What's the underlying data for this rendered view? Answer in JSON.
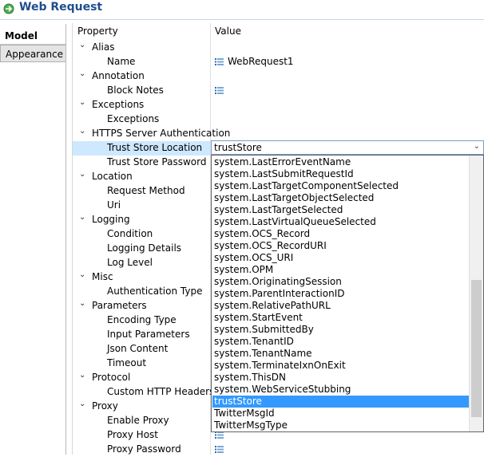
{
  "title": "Web Request",
  "tabs": [
    "Model",
    "Appearance"
  ],
  "headers": {
    "property": "Property",
    "value": "Value"
  },
  "rows": [
    {
      "label": "Alias",
      "level": 0
    },
    {
      "label": "Name",
      "level": 1,
      "value": "WebRequest1",
      "icon": "list-icon"
    },
    {
      "label": "Annotation",
      "level": 0
    },
    {
      "label": "Block Notes",
      "level": 1,
      "value": "",
      "icon": "list-icon"
    },
    {
      "label": "Exceptions",
      "level": 0
    },
    {
      "label": "Exceptions",
      "level": 1
    },
    {
      "label": "HTTPS Server Authentication",
      "level": 0
    },
    {
      "label": "Trust Store Location",
      "level": 1,
      "selected": true
    },
    {
      "label": "Trust Store Password",
      "level": 1
    },
    {
      "label": "Location",
      "level": 0
    },
    {
      "label": "Request Method",
      "level": 1
    },
    {
      "label": "Uri",
      "level": 1
    },
    {
      "label": "Logging",
      "level": 0
    },
    {
      "label": "Condition",
      "level": 1
    },
    {
      "label": "Logging Details",
      "level": 1
    },
    {
      "label": "Log Level",
      "level": 1
    },
    {
      "label": "Misc",
      "level": 0
    },
    {
      "label": "Authentication Type",
      "level": 1
    },
    {
      "label": "Parameters",
      "level": 0
    },
    {
      "label": "Encoding Type",
      "level": 1
    },
    {
      "label": "Input Parameters",
      "level": 1
    },
    {
      "label": "Json Content",
      "level": 1
    },
    {
      "label": "Timeout",
      "level": 1
    },
    {
      "label": "Protocol",
      "level": 0
    },
    {
      "label": "Custom HTTP Headers",
      "level": 1
    },
    {
      "label": "Proxy",
      "level": 0
    },
    {
      "label": "Enable Proxy",
      "level": 1
    },
    {
      "label": "Proxy Host",
      "level": 1,
      "value": "",
      "icon": "list-icon"
    },
    {
      "label": "Proxy Password",
      "level": 1,
      "value": "",
      "icon": "list-icon"
    }
  ],
  "combo": {
    "value": "trustStore"
  },
  "dropdown": {
    "items": [
      "system.LastErrorEventName",
      "system.LastSubmitRequestId",
      "system.LastTargetComponentSelected",
      "system.LastTargetObjectSelected",
      "system.LastTargetSelected",
      "system.LastVirtualQueueSelected",
      "system.OCS_Record",
      "system.OCS_RecordURI",
      "system.OCS_URI",
      "system.OPM",
      "system.OriginatingSession",
      "system.ParentInteractionID",
      "system.RelativePathURL",
      "system.StartEvent",
      "system.SubmittedBy",
      "system.TenantID",
      "system.TenantName",
      "system.TerminateIxnOnExit",
      "system.ThisDN",
      "system.WebServiceStubbing",
      "trustStore",
      "TwitterMsgId",
      "TwitterMsgType"
    ],
    "selected": "trustStore"
  },
  "colors": {
    "title": "#1f4e8c",
    "selection": "#cde8ff",
    "highlight": "#3399ff"
  }
}
